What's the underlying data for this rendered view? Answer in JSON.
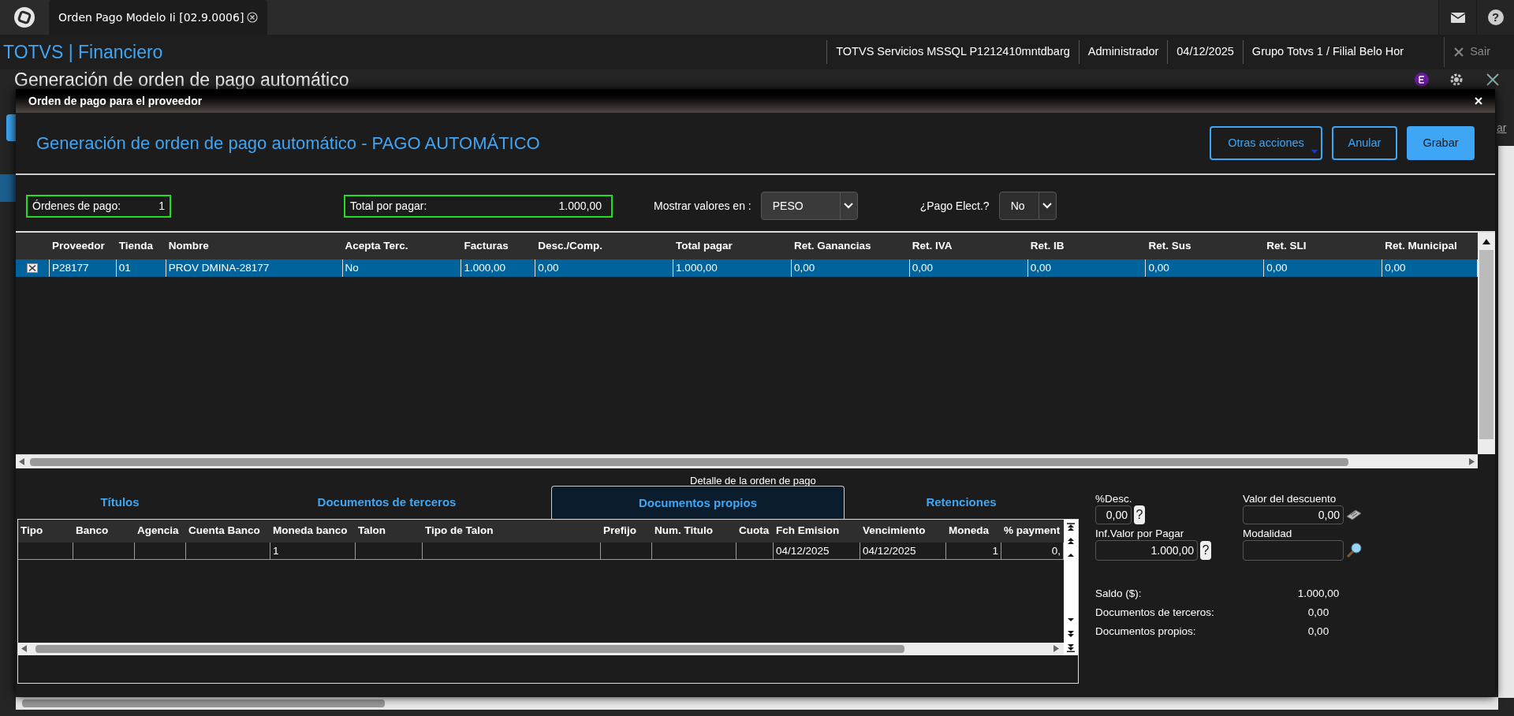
{
  "app_tab": {
    "title": "Orden Pago Modelo Ii [02.9.0006]"
  },
  "header": {
    "brand": "TOTVS | Financiero",
    "info": [
      "TOTVS Servicios MSSQL P1212410mntdbarg",
      "Administrador",
      "04/12/2025",
      "Grupo Totvs 1 / Filial Belo Hor"
    ],
    "exit": "Sair",
    "help": "?"
  },
  "background_page": {
    "title": "Generación de orden de pago automático",
    "link": "ar"
  },
  "dialog": {
    "title": "Orden de pago para el proveedor",
    "heading": "Generación de orden de pago automático - PAGO AUTOMÁTICO",
    "actions": [
      {
        "label": "Otras acciones",
        "kind": "menu"
      },
      {
        "label": "Anular",
        "kind": "outline"
      },
      {
        "label": "Grabar",
        "kind": "primary"
      }
    ],
    "summary": {
      "orders_label": "Órdenes de pago:",
      "orders_value": "1",
      "total_label": "Total por pagar:",
      "total_value": "1.000,00",
      "currency_label": "Mostrar valores en :",
      "currency": "PESO",
      "electronic_label": "¿Pago Elect.?",
      "electronic": "No"
    },
    "suppliers": {
      "columns": [
        "Proveedor",
        "Tienda",
        "Nombre",
        "Acepta Terc.",
        "Facturas",
        "Desc./Comp.",
        "Total pagar",
        "Ret. Ganancias",
        "Ret. IVA",
        "Ret. IB",
        "Ret. Sus",
        "Ret. SLI",
        "Ret. Municipal"
      ],
      "rows": [
        {
          "checked": true,
          "selected": true,
          "cells": [
            "P28177",
            "01",
            "PROV DMINA-28177",
            "No",
            "1.000,00",
            "0,00",
            "1.000,00",
            "0,00",
            "0,00",
            "0,00",
            "0,00",
            "0,00",
            "0,00"
          ]
        }
      ]
    },
    "detail": {
      "caption": "Detalle de la orden de pago",
      "tabs": [
        {
          "label": "Títulos",
          "selected": false
        },
        {
          "label": "Documentos de terceros",
          "selected": false
        },
        {
          "label": "Documentos propios",
          "selected": true
        },
        {
          "label": "Retenciones",
          "selected": false
        }
      ],
      "documents": {
        "columns": [
          "Tipo",
          "Banco",
          "Agencia",
          "Cuenta Banco",
          "Moneda banco",
          "Talon",
          "Tipo de Talon",
          "Prefijo",
          "Num. Titulo",
          "Cuota",
          "Fch Emision",
          "Vencimiento",
          "Moneda",
          "% payment"
        ],
        "rows": [
          {
            "cells": [
              "",
              "",
              "",
              "",
              "1",
              "",
              "",
              "",
              "",
              "",
              "04/12/2025",
              "04/12/2025",
              "1",
              "0,"
            ]
          }
        ]
      },
      "fields": [
        {
          "label": "%Desc.",
          "value": "0,00",
          "kind": "help",
          "button": "?"
        },
        {
          "label": "Valor del descuento",
          "value": "0,00",
          "kind": "calculator"
        },
        {
          "label": "Inf.Valor por Pagar",
          "value": "1.000,00",
          "kind": "help",
          "button": "?"
        },
        {
          "label": "Modalidad",
          "kind": "lookup"
        }
      ],
      "totals": [
        {
          "label": "Saldo ($):",
          "value": "1.000,00"
        },
        {
          "label": "Documentos de terceros:",
          "value": "0,00"
        },
        {
          "label": "Documentos propios:",
          "value": "0,00"
        }
      ]
    }
  }
}
